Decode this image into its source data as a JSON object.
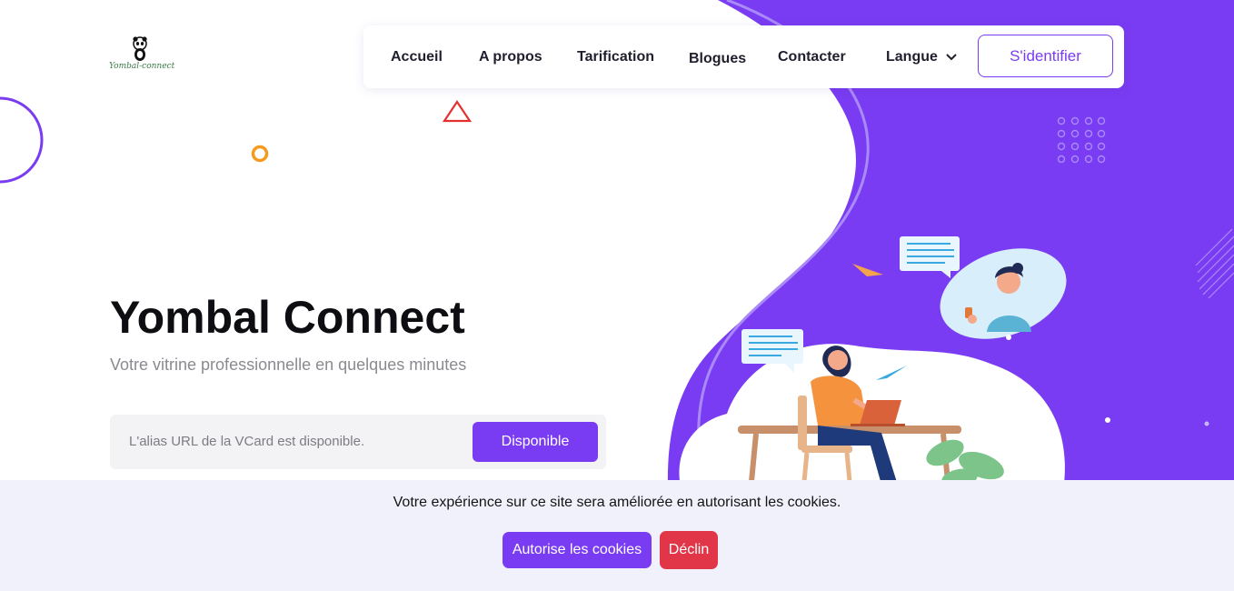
{
  "brand": {
    "logo_text": "Yombal-connect"
  },
  "nav": {
    "items": [
      "Accueil",
      "A propos",
      "Tarification",
      "Blogues",
      "Contacter",
      "Langue"
    ],
    "login_label": "S'identifier"
  },
  "hero": {
    "title": "Yombal Connect",
    "subtitle": "Votre vitrine professionnelle en quelques minutes",
    "alias_message": "L'alias URL de la VCard est disponible.",
    "alias_button": "Disponible"
  },
  "cookies": {
    "message": "Votre expérience sur ce site sera améliorée en autorisant les cookies.",
    "accept_label": "Autorise les cookies",
    "decline_label": "Déclin"
  },
  "colors": {
    "accent": "#7a3cf2",
    "decline": "#e03648",
    "cookie_bg": "#f1f1fc"
  }
}
